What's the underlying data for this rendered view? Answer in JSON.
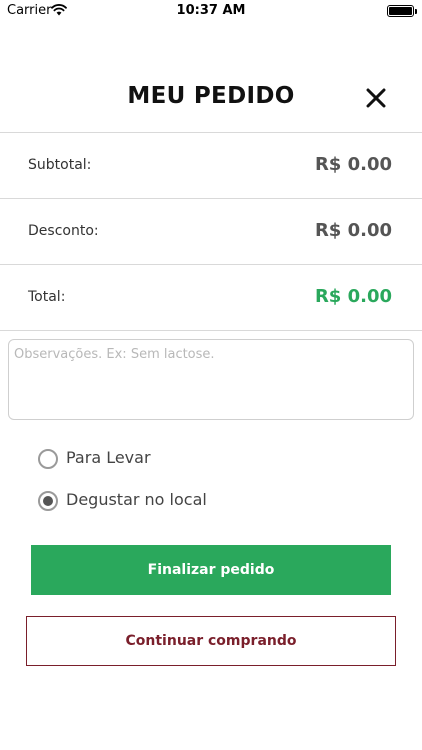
{
  "status_bar": {
    "carrier": "Carrier",
    "time": "10:37 AM",
    "icons": [
      "wifi-icon",
      "battery-icon"
    ]
  },
  "header": {
    "title": "MEU PEDIDO",
    "close_icon": "close-icon"
  },
  "summary": {
    "subtotal": {
      "label": "Subtotal:",
      "value": "R$ 0.00"
    },
    "desconto": {
      "label": "Desconto:",
      "value": "R$ 0.00"
    },
    "total": {
      "label": "Total:",
      "value": "R$ 0.00"
    }
  },
  "notes": {
    "value": "",
    "placeholder": "Observações. Ex: Sem lactose."
  },
  "options": {
    "levar": {
      "label": "Para Levar",
      "selected": false
    },
    "local": {
      "label": "Degustar no local",
      "selected": true
    }
  },
  "actions": {
    "finalizar_label": "Finalizar pedido",
    "continuar_label": "Continuar comprando"
  },
  "colors": {
    "primary_green": "#2aa85c",
    "accent_maroon": "#7a1f2b"
  }
}
